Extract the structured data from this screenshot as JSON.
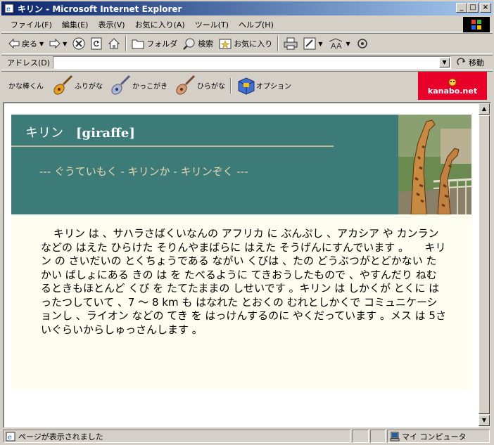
{
  "window": {
    "title": "キリン - Microsoft Internet Explorer"
  },
  "menu": {
    "items": [
      "ファイル(F)",
      "編集(E)",
      "表示(V)",
      "お気に入り(A)",
      "ツール(T)",
      "ヘルプ(H)"
    ]
  },
  "toolbar": {
    "back": "戻る",
    "folder": "フォルダ",
    "search": "検索",
    "favorites": "お気に入り"
  },
  "address": {
    "label": "アドレス(D)",
    "value": "",
    "go": "移動"
  },
  "kanabar": {
    "label": "かな棒くん",
    "items": [
      "ふりがな",
      "かっこがき",
      "ひらがな",
      "オプション"
    ],
    "logo": "kanabo.net"
  },
  "page": {
    "title_ja": "キリン",
    "title_en": "[giraffe]",
    "subtitle": "--- ぐうていもく - キリンか - キリンぞく ---",
    "body": "キリン は 、サハラさばくいなんの アフリカ に ぶんぷし 、アカシア や カンラン などの はえた ひらけた そりんやまばらに はえた そうげんにすんでいます 。　　キリン の さいだいの とくちょうである ながい くびは 、たの どうぶつがとどかない たかい ばしょにある きの は を たべるように てきおうしたもので 、やすんだり ねむるときもほとんど くび を たてたままの しせいです 。キリン は しかくが とくに はったつしていて 、7 〜 8 km も はなれた とおくの むれとしかくで コミュニケーションし 、ライオン などの てき を はっけんするのに やくだっています 。メス は 5さいぐらいからしゅっさんします 。"
  },
  "status": {
    "text": "ページが表示されました",
    "zone": "マイ コンピュータ"
  },
  "colors": {
    "header_bg": "#3d7b78",
    "body_bg": "#fdfdf0",
    "titlebar_start": "#0a246a",
    "logo_bg": "#e8002a"
  }
}
